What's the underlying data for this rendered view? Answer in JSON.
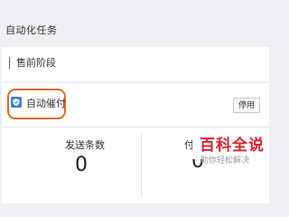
{
  "page": {
    "title": "自动化任务"
  },
  "section": {
    "title": "售前阶段"
  },
  "task": {
    "name": "自动催付",
    "disable_label": "停用",
    "icon": "shield-check-icon",
    "highlight_color": "#e66a1f"
  },
  "stats": [
    {
      "label": "发送条数",
      "value": "0"
    },
    {
      "label": "付",
      "value": "0"
    }
  ],
  "watermark": {
    "title": "百科全说",
    "subtitle": "助你轻松解决"
  }
}
